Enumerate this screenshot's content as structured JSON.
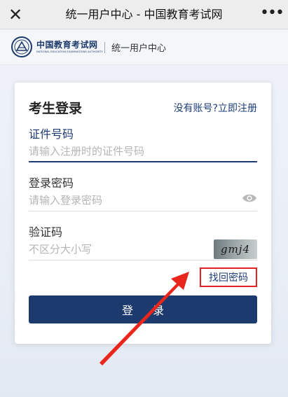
{
  "topbar": {
    "close_icon": "close-icon",
    "title": "统一用户中心 - 中国教育考试网",
    "more_icon": "more-icon"
  },
  "brand": {
    "name_cn": "中国教育考试网",
    "name_en": "NATIONAL EDUCATION EXAMINATIONS AUTHORITY",
    "section": "统一用户中心"
  },
  "login": {
    "title": "考生登录",
    "register_link": "没有账号?立即注册",
    "id_label": "证件号码",
    "id_placeholder": "请输入注册时的证件号码",
    "password_label": "登录密码",
    "password_placeholder": "请输入登录密码",
    "captcha_label": "验证码",
    "captcha_placeholder": "不区分大小写",
    "captcha_text": "gmj4",
    "forgot_link": "找回密码",
    "submit_label": "登录"
  },
  "colors": {
    "accent": "#1d3a6e",
    "highlight_box": "#e02424",
    "arrow": "#e8261c"
  }
}
